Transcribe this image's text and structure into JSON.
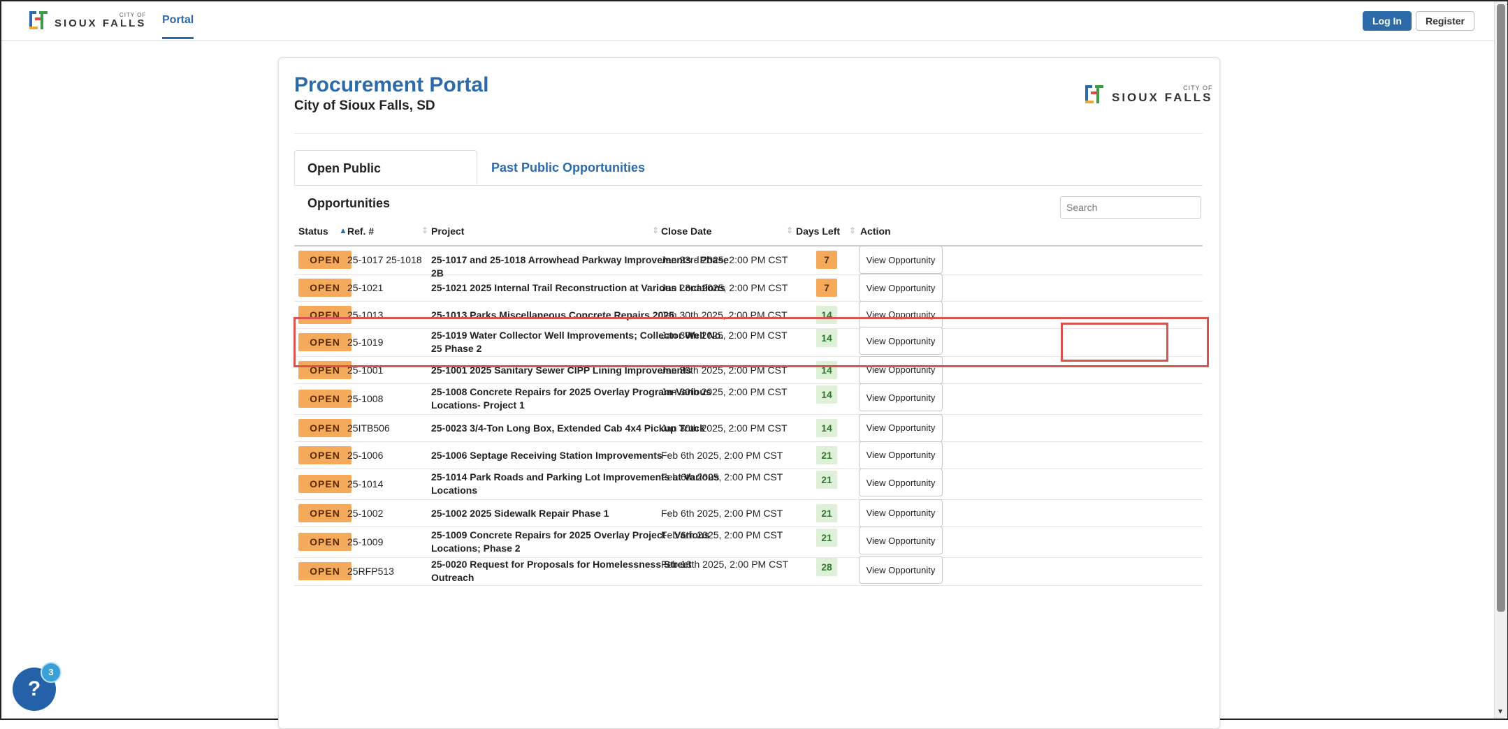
{
  "nav": {
    "logo_top": "CITY OF",
    "logo_bottom": "SIOUX FALLS",
    "portal_label": "Portal",
    "login_label": "Log In",
    "register_label": "Register"
  },
  "header": {
    "title": "Procurement Portal",
    "subtitle": "City of Sioux Falls, SD",
    "logo_top": "CITY OF",
    "logo_bottom": "SIOUX FALLS"
  },
  "tabs": [
    {
      "label": "Open Public Opportunities",
      "active": true
    },
    {
      "label": "Past Public Opportunities",
      "active": false
    }
  ],
  "search": {
    "placeholder": "Search"
  },
  "table": {
    "columns": [
      "Status",
      "Ref. #",
      "Project",
      "Close Date",
      "Days Left",
      "Action"
    ],
    "rows": [
      {
        "status": "OPEN",
        "ref": "25-1017 25-1018",
        "project": "25-1017 and 25-1018 Arrowhead Parkway Improvements - Phase 2B",
        "close_date": "Jan 23rd 2025, 2:00 PM CST",
        "days_left": "7",
        "days_color": "orange",
        "action": "View Opportunity"
      },
      {
        "status": "OPEN",
        "ref": "25-1021",
        "project": "25-1021 2025 Internal Trail Reconstruction at Various Locations",
        "close_date": "Jan 23rd 2025, 2:00 PM CST",
        "days_left": "7",
        "days_color": "orange",
        "action": "View Opportunity"
      },
      {
        "status": "OPEN",
        "ref": "25-1013",
        "project": "25-1013 Parks Miscellaneous Concrete Repairs 2025",
        "close_date": "Jan 30th 2025, 2:00 PM CST",
        "days_left": "14",
        "days_color": "green",
        "action": "View Opportunity"
      },
      {
        "status": "OPEN",
        "ref": "25-1019",
        "project": "25-1019 Water Collector Well Improvements; Collector Well No. 25 Phase 2",
        "close_date": "Jan 30th 2025, 2:00 PM CST",
        "days_left": "14",
        "days_color": "green",
        "action": "View Opportunity"
      },
      {
        "status": "OPEN",
        "ref": "25-1001",
        "project": "25-1001 2025 Sanitary Sewer CIPP Lining Improvements",
        "close_date": "Jan 30th 2025, 2:00 PM CST",
        "days_left": "14",
        "days_color": "green",
        "action": "View Opportunity"
      },
      {
        "status": "OPEN",
        "ref": "25-1008",
        "project": "25-1008 Concrete Repairs for 2025 Overlay Program-Various Locations- Project 1",
        "close_date": "Jan 30th 2025, 2:00 PM CST",
        "days_left": "14",
        "days_color": "green",
        "action": "View Opportunity"
      },
      {
        "status": "OPEN",
        "ref": "25ITB506",
        "project": "25-0023 3/4-Ton Long Box, Extended Cab 4x4 Pickup Truck",
        "close_date": "Jan 30th 2025, 2:00 PM CST",
        "days_left": "14",
        "days_color": "green",
        "action": "View Opportunity"
      },
      {
        "status": "OPEN",
        "ref": "25-1006",
        "project": "25-1006 Septage Receiving Station Improvements",
        "close_date": "Feb 6th 2025, 2:00 PM CST",
        "days_left": "21",
        "days_color": "green",
        "action": "View Opportunity"
      },
      {
        "status": "OPEN",
        "ref": "25-1014",
        "project": "25-1014 Park Roads and Parking Lot Improvements at Various Locations",
        "close_date": "Feb 6th 2025, 2:00 PM CST",
        "days_left": "21",
        "days_color": "green",
        "action": "View Opportunity"
      },
      {
        "status": "OPEN",
        "ref": "25-1002",
        "project": "25-1002 2025 Sidewalk Repair Phase 1",
        "close_date": "Feb 6th 2025, 2:00 PM CST",
        "days_left": "21",
        "days_color": "green",
        "action": "View Opportunity"
      },
      {
        "status": "OPEN",
        "ref": "25-1009",
        "project": "25-1009 Concrete Repairs for 2025 Overlay Project - Various Locations; Phase 2",
        "close_date": "Feb 6th 2025, 2:00 PM CST",
        "days_left": "21",
        "days_color": "green",
        "action": "View Opportunity"
      },
      {
        "status": "OPEN",
        "ref": "25RFP513",
        "project": "25-0020 Request for Proposals for Homelessness Street Outreach",
        "close_date": "Feb 13th 2025, 2:00 PM CST",
        "days_left": "28",
        "days_color": "green",
        "action": "View Opportunity"
      }
    ]
  },
  "help": {
    "label": "?",
    "badge": "3"
  },
  "colors": {
    "brand": "#2c6aa9",
    "open_badge": "#f5a95a",
    "days_green": "#def0d8",
    "highlight": "#d9534f"
  }
}
